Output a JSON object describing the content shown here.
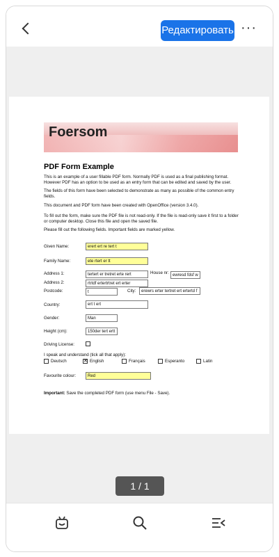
{
  "toolbar": {
    "edit_label": "Редактировать",
    "more_label": "···"
  },
  "pdf": {
    "logo": "Foersom",
    "title": "PDF Form Example",
    "paragraphs": [
      "This is an example of a user fillable PDF form. Normally PDF is used as a final publishing format. However PDF has an option to be used as an entry form that can be edited and saved by the user.",
      "The fields of this form have been selected to demonstrate as many as possible of the common entry fields.",
      "This document and PDF form have been created with OpenOffice (version 3.4.0).",
      "To fill out the form, make sure the PDF file is not read-only. If the file is read-only save it first to a folder or computer desktop. Close this file and open the saved file.",
      "Please fill out the following fields. Important fields are marked yellow."
    ],
    "form": {
      "given_name_label": "Given Name:",
      "given_name": "erert ert re tert t",
      "family_name_label": "Family Name:",
      "family_name": "ete rtert er tt",
      "address1_label": "Address 1:",
      "address1": "tertert er tretret  erte rert",
      "house_nr_label": "House nr:",
      "house_nr": "ewresd fdsf w",
      "address2_label": "Address 2:",
      "address2": "rtrtdf ertertrtret ert erter",
      "postcode_label": "Postcode:",
      "postcode": "t",
      "city_label": "City:",
      "city": "erewrs erter tertret ert ertertd f",
      "country_label": "Country:",
      "country": "ert t ert",
      "gender_label": "Gender:",
      "gender": "Man",
      "height_label": "Height (cm):",
      "height": "150der tert ertt",
      "driving_label": "Driving License:",
      "languages_label": "I speak and understand (tick all that apply):",
      "languages": [
        {
          "name": "Deutsch",
          "checked": false
        },
        {
          "name": "English",
          "checked": true
        },
        {
          "name": "Français",
          "checked": false
        },
        {
          "name": "Esperanto",
          "checked": false
        },
        {
          "name": "Latin",
          "checked": false
        }
      ],
      "colour_label": "Favourite colour:",
      "colour": "Red"
    },
    "note_bold": "Important:",
    "note_text": " Save the completed PDF form (use menu File - Save)."
  },
  "pager": {
    "label": "1 / 1"
  },
  "icons": [
    "back-icon",
    "more-icon",
    "bot-icon",
    "search-icon",
    "outline-icon"
  ]
}
